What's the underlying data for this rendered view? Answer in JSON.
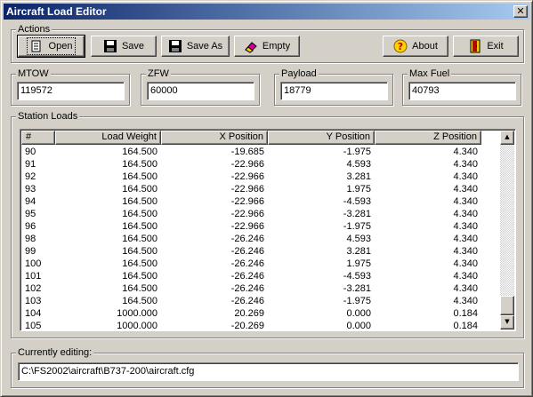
{
  "window": {
    "title": "Aircraft Load Editor",
    "close_glyph": "✕"
  },
  "actions": {
    "group_label": "Actions",
    "open_label": "Open",
    "save_label": "Save",
    "save_as_label": "Save As",
    "empty_label": "Empty",
    "about_label": "About",
    "exit_label": "Exit"
  },
  "weights": {
    "mtow_label": "MTOW",
    "mtow_value": "119572",
    "zfw_label": "ZFW",
    "zfw_value": "60000",
    "payload_label": "Payload",
    "payload_value": "18779",
    "max_fuel_label": "Max Fuel",
    "max_fuel_value": "40793"
  },
  "station_loads": {
    "group_label": "Station Loads",
    "columns": [
      "#",
      "Load Weight",
      "X Position",
      "Y Position",
      "Z Position"
    ],
    "rows": [
      [
        "90",
        "164.500",
        "-19.685",
        "-1.975",
        "4.340"
      ],
      [
        "91",
        "164.500",
        "-22.966",
        "4.593",
        "4.340"
      ],
      [
        "92",
        "164.500",
        "-22.966",
        "3.281",
        "4.340"
      ],
      [
        "93",
        "164.500",
        "-22.966",
        "1.975",
        "4.340"
      ],
      [
        "94",
        "164.500",
        "-22.966",
        "-4.593",
        "4.340"
      ],
      [
        "95",
        "164.500",
        "-22.966",
        "-3.281",
        "4.340"
      ],
      [
        "96",
        "164.500",
        "-22.966",
        "-1.975",
        "4.340"
      ],
      [
        "98",
        "164.500",
        "-26.246",
        "4.593",
        "4.340"
      ],
      [
        "99",
        "164.500",
        "-26.246",
        "3.281",
        "4.340"
      ],
      [
        "100",
        "164.500",
        "-26.246",
        "1.975",
        "4.340"
      ],
      [
        "101",
        "164.500",
        "-26.246",
        "-4.593",
        "4.340"
      ],
      [
        "102",
        "164.500",
        "-26.246",
        "-3.281",
        "4.340"
      ],
      [
        "103",
        "164.500",
        "-26.246",
        "-1.975",
        "4.340"
      ],
      [
        "104",
        "1000.000",
        "20.269",
        "0.000",
        "0.184"
      ],
      [
        "105",
        "1000.000",
        "-20.269",
        "0.000",
        "0.184"
      ]
    ],
    "scroll_up_glyph": "▲",
    "scroll_down_glyph": "▼"
  },
  "current": {
    "group_label": "Currently editing:",
    "path": "C:\\FS2002\\aircraft\\B737-200\\aircraft.cfg"
  },
  "icons": {
    "open": "open-folder-icon",
    "save": "floppy-disk-icon",
    "save_as": "floppy-disk-icon",
    "empty": "eraser-icon",
    "about": "question-icon",
    "exit": "exit-door-icon"
  }
}
